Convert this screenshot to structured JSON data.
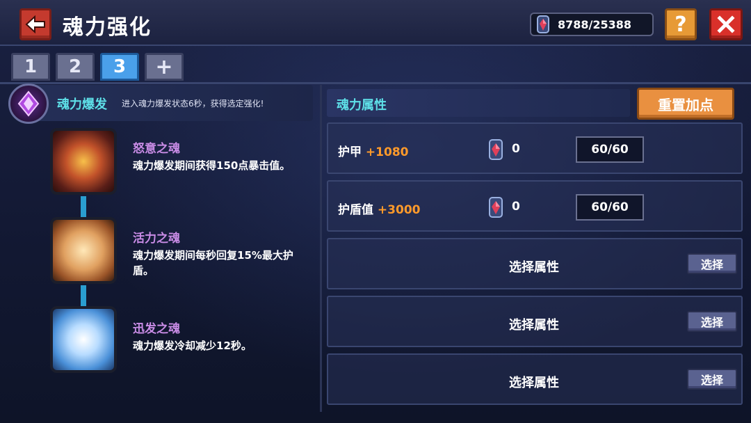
{
  "header": {
    "title": "魂力强化",
    "currency_amount": "8788/25388",
    "help_label": "?"
  },
  "tabs": [
    {
      "label": "1",
      "active": false
    },
    {
      "label": "2",
      "active": false
    },
    {
      "label": "3",
      "active": true
    },
    {
      "label": "+",
      "active": false
    }
  ],
  "burst": {
    "title": "魂力爆发",
    "desc": "进入魂力爆发状态6秒，获得选定强化!"
  },
  "souls": [
    {
      "name": "怒意之魂",
      "desc": "魂力爆发期间获得150点暴击值。"
    },
    {
      "name": "活力之魂",
      "desc": "魂力爆发期间每秒回复15%最大护盾。"
    },
    {
      "name": "迅发之魂",
      "desc": "魂力爆发冷却减少12秒。"
    }
  ],
  "attributes": {
    "title": "魂力属性",
    "reset_label": "重置加点",
    "rows": [
      {
        "label": "护甲",
        "bonus": "+1080",
        "count": "0",
        "level": "60/60"
      },
      {
        "label": "护盾值",
        "bonus": "+3000",
        "count": "0",
        "level": "60/60"
      }
    ],
    "empty_rows": [
      {
        "label": "选择属性",
        "button": "选择"
      },
      {
        "label": "选择属性",
        "button": "选择"
      },
      {
        "label": "选择属性",
        "button": "选择"
      }
    ]
  },
  "colors": {
    "accent_cyan": "#5ee0e8",
    "bonus_orange": "#ff9a2a",
    "soul_name_purple": "#c98ce6",
    "tab_active": "#4aa0ea"
  },
  "icons": [
    "back-arrow-icon",
    "soul-gem-icon",
    "help-icon",
    "close-icon",
    "burst-crystal-icon",
    "rage-soul-icon",
    "vitality-soul-icon",
    "swift-soul-icon"
  ]
}
